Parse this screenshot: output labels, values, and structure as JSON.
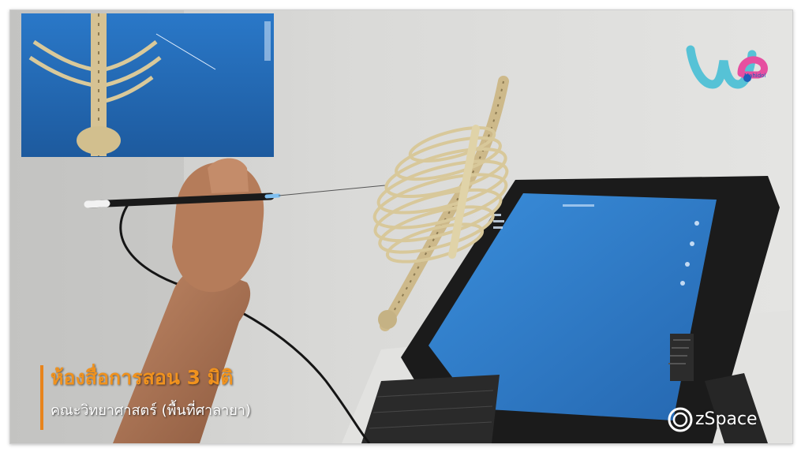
{
  "caption": {
    "title": "ห้องสื่อการสอน 3 มิติ",
    "subtitle": "คณะวิทยาศาสตร์ (พื้นที่ศาลายา)"
  },
  "logos": {
    "we_mahidol": "Mahidol",
    "zspace": "zSpace"
  },
  "colors": {
    "caption_accent": "#f0921e",
    "screen_blue": "#2f7fcc",
    "wall": "#d8d8d6"
  },
  "icons": [
    "stylus-icon",
    "skeleton-ribcage",
    "zspace-monitor",
    "we-mahidol-logo",
    "zspace-logo"
  ]
}
